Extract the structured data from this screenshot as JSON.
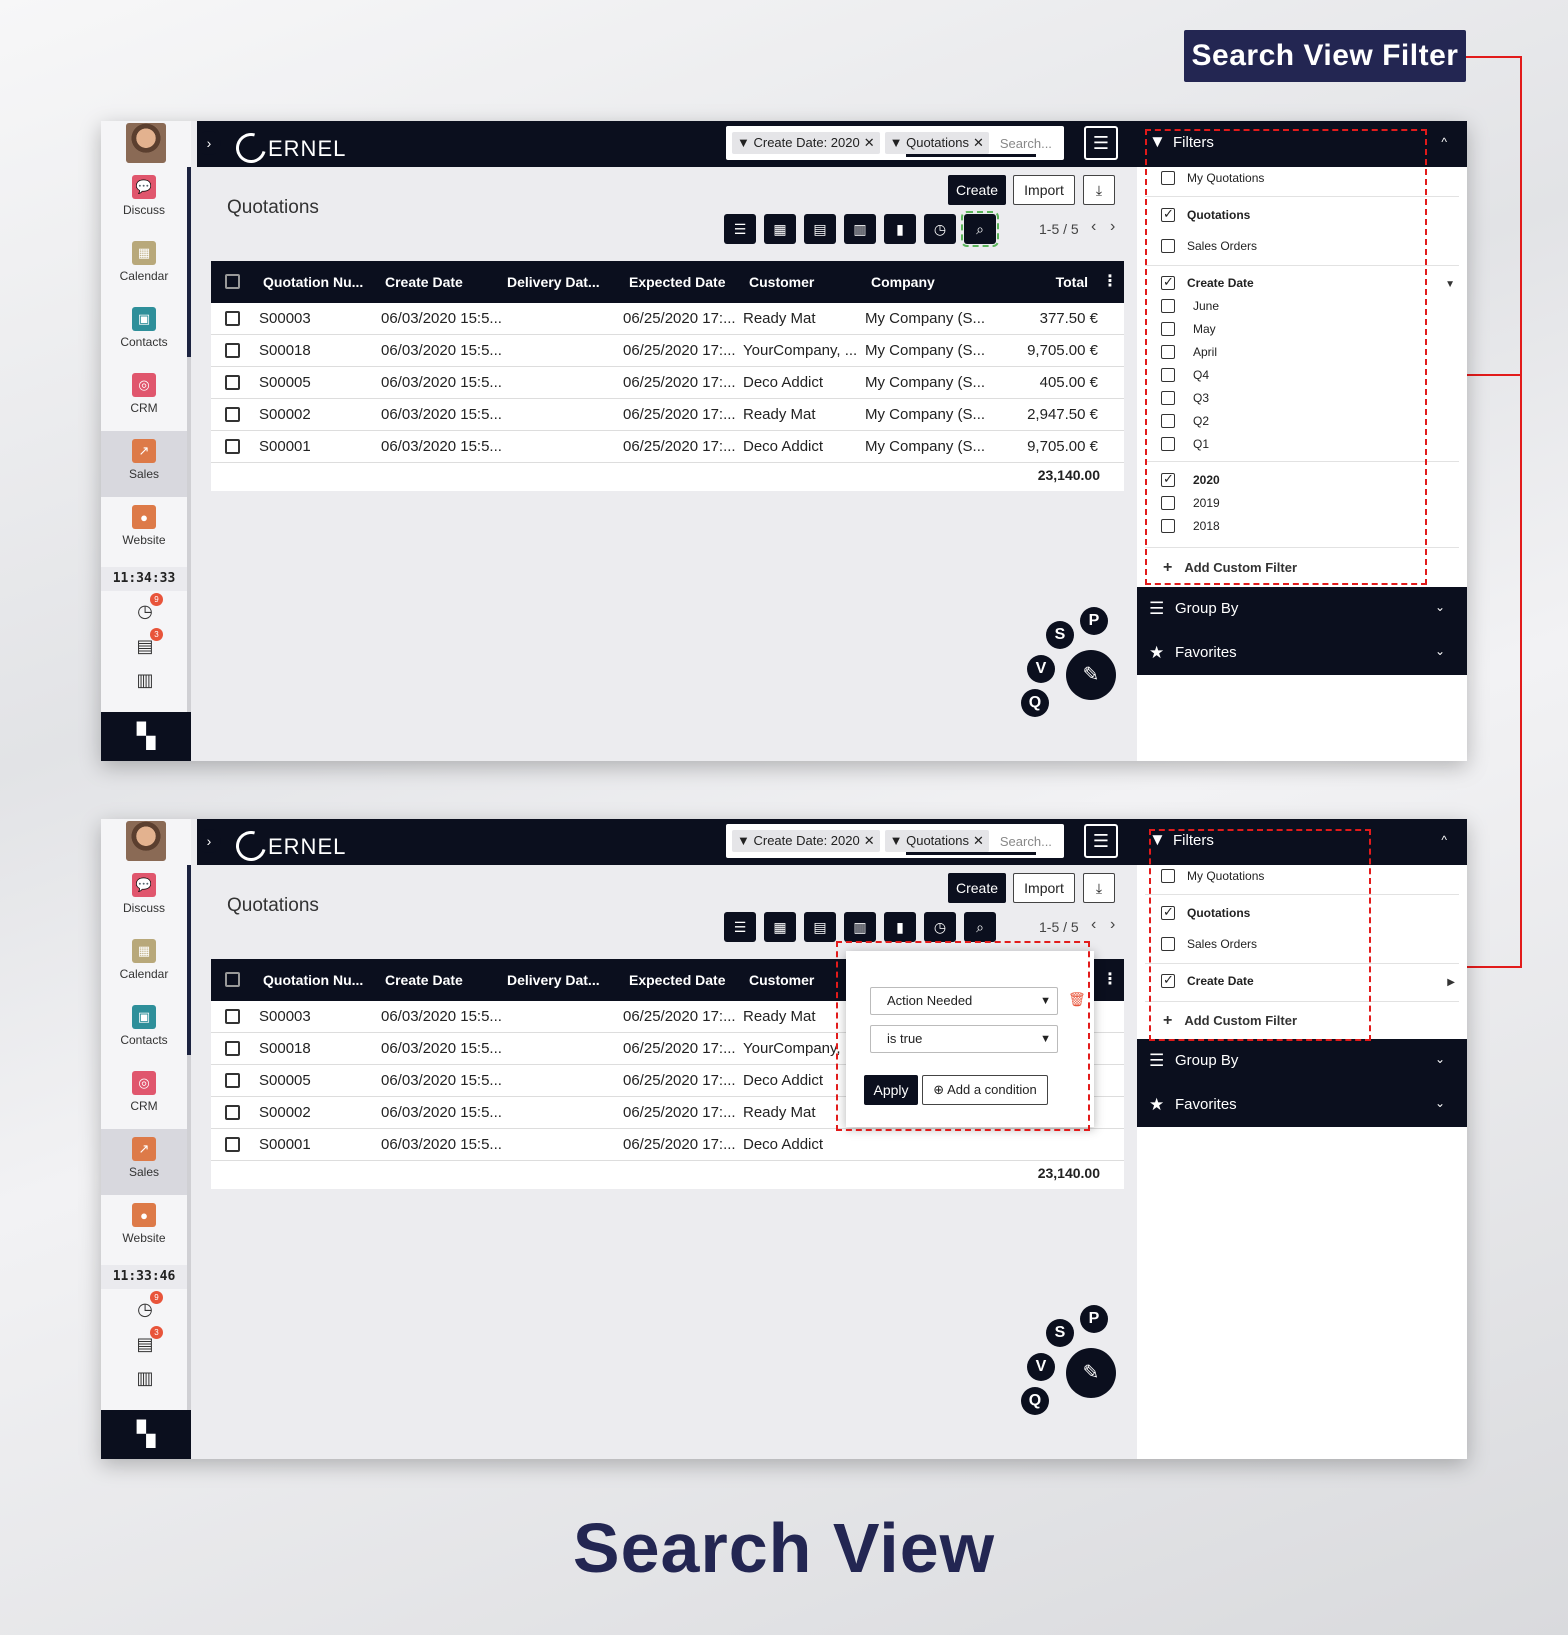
{
  "banner": "Search View Filter",
  "footer_title": "Search View",
  "accent_color": "#e21b1b",
  "brand_color": "#232652",
  "dark_color": "#0b0f1e",
  "logo_text": "ERNEL",
  "apps": [
    "Discuss",
    "Calendar",
    "Contacts",
    "CRM",
    "Sales",
    "Website"
  ],
  "app_icon_colors": [
    "#e0566d",
    "#b8a87a",
    "#2e8f9a",
    "#e0566d",
    "#dd7a48",
    "#dd7a48"
  ],
  "search": {
    "facets": [
      "Create Date: 2020",
      "Quotations"
    ],
    "placeholder": "Search..."
  },
  "page_title": "Quotations",
  "buttons": {
    "create": "Create",
    "import": "Import"
  },
  "view_icons": [
    "list-icon",
    "kanban-icon",
    "calendar-icon",
    "pivot-icon",
    "graph-icon",
    "activity-icon",
    "search-icon"
  ],
  "pager": "1-5 / 5",
  "columns": [
    "Quotation Nu...",
    "Create Date",
    "Delivery Dat...",
    "Expected Date",
    "Customer",
    "Company",
    "Total"
  ],
  "rows": [
    [
      "S00003",
      "06/03/2020 15:5...",
      "",
      "06/25/2020 17:...",
      "Ready Mat",
      "My Company (S...",
      "377.50 €"
    ],
    [
      "S00018",
      "06/03/2020 15:5...",
      "",
      "06/25/2020 17:...",
      "YourCompany, ...",
      "My Company (S...",
      "9,705.00 €"
    ],
    [
      "S00005",
      "06/03/2020 15:5...",
      "",
      "06/25/2020 17:...",
      "Deco Addict",
      "My Company (S...",
      "405.00 €"
    ],
    [
      "S00002",
      "06/03/2020 15:5...",
      "",
      "06/25/2020 17:...",
      "Ready Mat",
      "My Company (S...",
      "2,947.50 €"
    ],
    [
      "S00001",
      "06/03/2020 15:5...",
      "",
      "06/25/2020 17:...",
      "Deco Addict",
      "My Company (S...",
      "9,705.00 €"
    ]
  ],
  "total_sum": "23,140.00",
  "total_sum_partial": "23,140.00",
  "fab_letters": {
    "p": "P",
    "s": "S",
    "v": "V",
    "q": "Q"
  },
  "panel": {
    "filters": "Filters",
    "my_quotations": "My Quotations",
    "quotations": "Quotations",
    "sales_orders": "Sales Orders",
    "create_date": "Create Date",
    "periods": [
      "June",
      "May",
      "April",
      "Q4",
      "Q3",
      "Q2",
      "Q1"
    ],
    "years": [
      "2020",
      "2019",
      "2018"
    ],
    "add_custom_filter": "Add Custom Filter",
    "group_by": "Group By",
    "favorites": "Favorites"
  },
  "shots": [
    {
      "clock": "11:34:33",
      "badge_activity": "9",
      "badge_messages": "3"
    },
    {
      "clock": "11:33:46",
      "badge_activity": "9",
      "badge_messages": "3"
    }
  ],
  "custom_filter": {
    "field": "Action Needed",
    "operator": "is true",
    "apply": "Apply",
    "add_condition": "Add a condition"
  }
}
